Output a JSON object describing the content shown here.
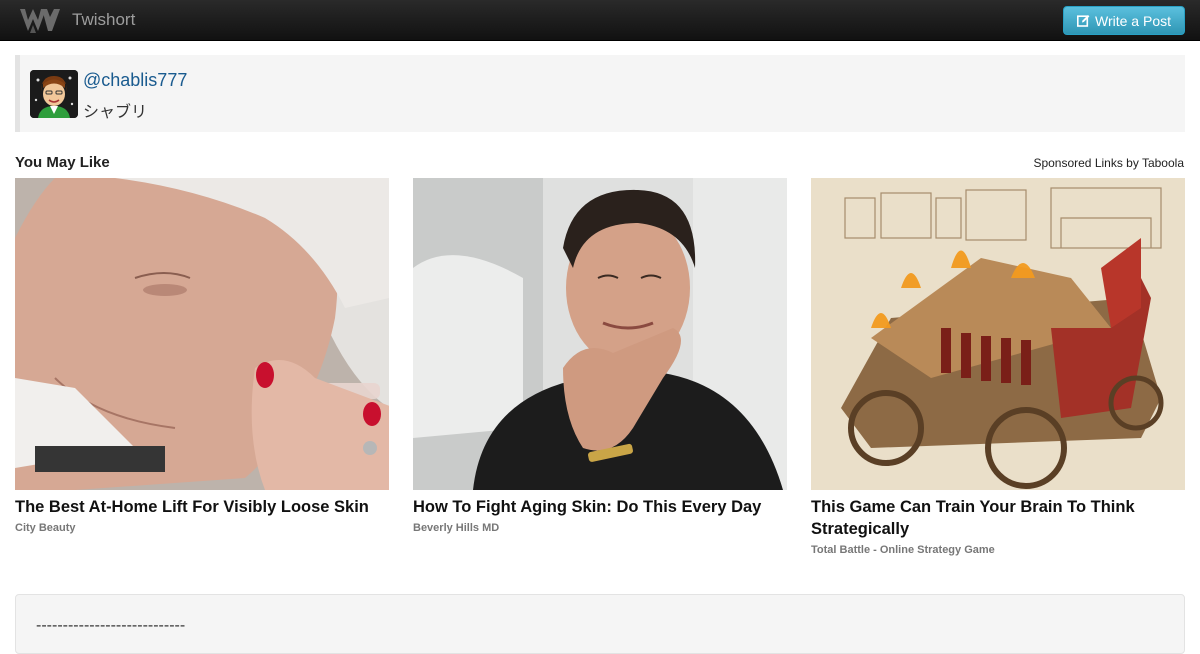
{
  "navbar": {
    "app_name": "Twishort",
    "write_button_label": "Write a Post",
    "brand_color": "#222222",
    "button_color": "#49afcd"
  },
  "profile": {
    "handle": "@chablis777",
    "name": "シャブリ"
  },
  "recommendations": {
    "heading": "You May Like",
    "sponsored_label": "Sponsored Links by Taboola",
    "items": [
      {
        "title": "The Best At-Home Lift For Visibly Loose Skin",
        "source": "City Beauty",
        "image": "woman-skin-lift-photo"
      },
      {
        "title": "How To Fight Aging Skin: Do This Every Day",
        "source": "Beverly Hills MD",
        "image": "doctor-portrait-photo"
      },
      {
        "title": "This Game Can Train Your Brain To Think Strategically",
        "source": "Total Battle - Online Strategy Game",
        "image": "siege-engine-illustration"
      }
    ]
  },
  "post": {
    "divider_text": "----------------------------"
  }
}
